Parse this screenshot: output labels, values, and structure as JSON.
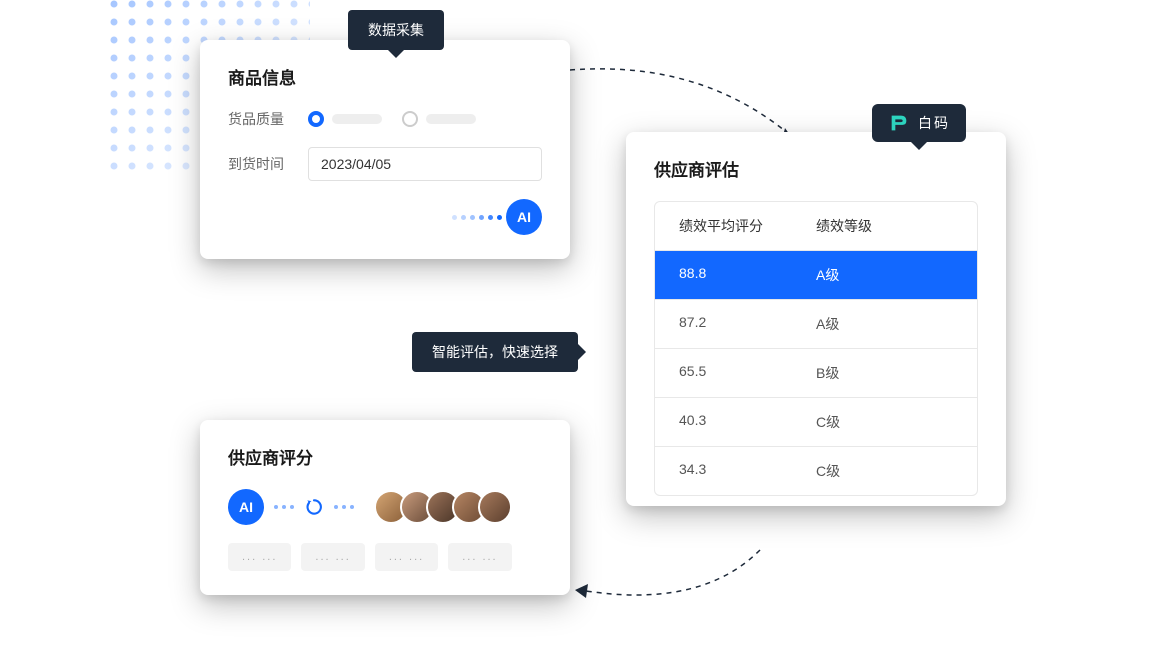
{
  "badges": {
    "data_collection": "数据采集",
    "smart_evaluation": "智能评估，快速选择",
    "baima": "白码"
  },
  "card1": {
    "title": "商品信息",
    "quality_label": "货品质量",
    "arrival_label": "到货时间",
    "arrival_value": "2023/04/05",
    "ai_label": "AI"
  },
  "card2": {
    "title": "供应商评估",
    "columns": {
      "score": "绩效平均评分",
      "level": "绩效等级"
    },
    "rows": [
      {
        "score": "88.8",
        "level": "A级",
        "selected": true
      },
      {
        "score": "87.2",
        "level": "A级",
        "selected": false
      },
      {
        "score": "65.5",
        "level": "B级",
        "selected": false
      },
      {
        "score": "40.3",
        "level": "C级",
        "selected": false
      },
      {
        "score": "34.3",
        "level": "C级",
        "selected": false
      }
    ]
  },
  "card3": {
    "title": "供应商评分",
    "ai_label": "AI",
    "placeholder": "... ..."
  }
}
